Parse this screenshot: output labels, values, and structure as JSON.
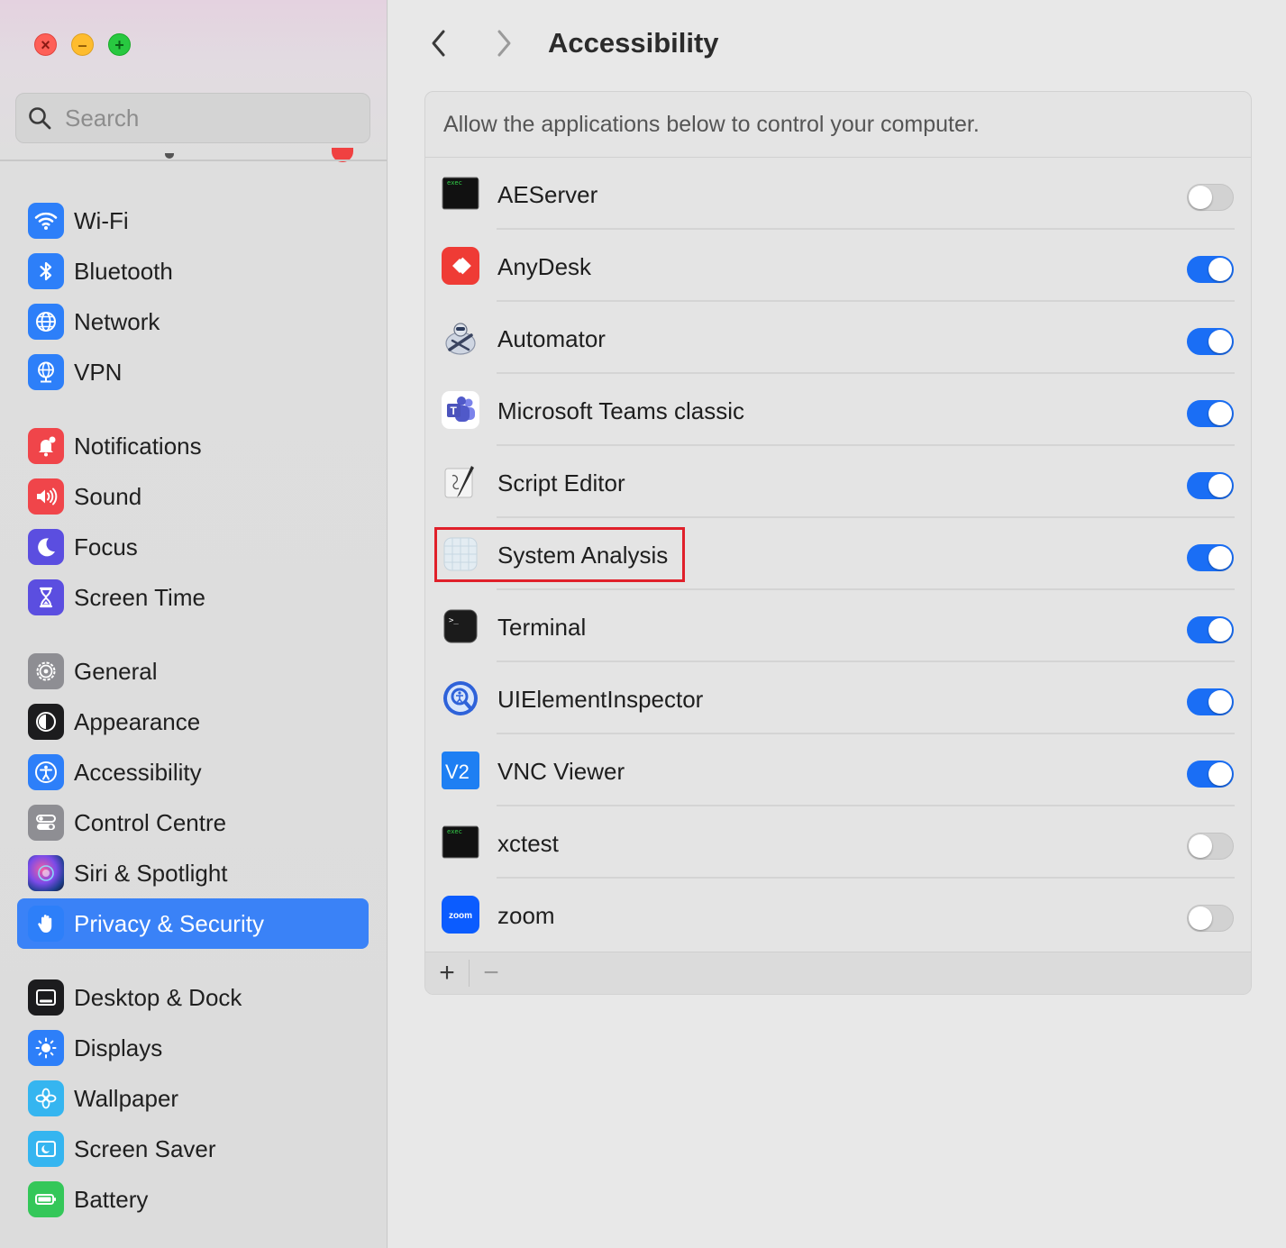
{
  "window": {
    "title": "Accessibility"
  },
  "search": {
    "placeholder": "Search"
  },
  "sidebar": {
    "items": [
      {
        "label": "Wi-Fi",
        "icon": "wifi-icon",
        "color": "#2d7ff9"
      },
      {
        "label": "Bluetooth",
        "icon": "bluetooth-icon",
        "color": "#2d7ff9"
      },
      {
        "label": "Network",
        "icon": "globe-icon",
        "color": "#2d7ff9"
      },
      {
        "label": "VPN",
        "icon": "vpn-globe-icon",
        "color": "#2d7ff9"
      },
      {
        "label": "Notifications",
        "icon": "bell-icon",
        "color": "#f0454a"
      },
      {
        "label": "Sound",
        "icon": "speaker-icon",
        "color": "#f0454a"
      },
      {
        "label": "Focus",
        "icon": "moon-icon",
        "color": "#5b4ee0"
      },
      {
        "label": "Screen Time",
        "icon": "hourglass-icon",
        "color": "#5b4ee0"
      },
      {
        "label": "General",
        "icon": "gear-icon",
        "color": "#8e8e93"
      },
      {
        "label": "Appearance",
        "icon": "appearance-icon",
        "color": "#1c1c1e"
      },
      {
        "label": "Accessibility",
        "icon": "accessibility-icon",
        "color": "#2d7ff9"
      },
      {
        "label": "Control Centre",
        "icon": "control-centre-icon",
        "color": "#8e8e93"
      },
      {
        "label": "Siri & Spotlight",
        "icon": "siri-icon",
        "color": "#2a1f4d"
      },
      {
        "label": "Privacy & Security",
        "icon": "hand-icon",
        "color": "#2d7ff9",
        "active": true
      },
      {
        "label": "Desktop & Dock",
        "icon": "dock-icon",
        "color": "#1c1c1e"
      },
      {
        "label": "Displays",
        "icon": "sun-icon",
        "color": "#2d7ff9"
      },
      {
        "label": "Wallpaper",
        "icon": "flower-icon",
        "color": "#35b5f0"
      },
      {
        "label": "Screen Saver",
        "icon": "screen-saver-icon",
        "color": "#35b5f0"
      },
      {
        "label": "Battery",
        "icon": "battery-icon",
        "color": "#34c759"
      }
    ]
  },
  "main": {
    "description": "Allow the applications below to control your computer.",
    "apps": [
      {
        "name": "AEServer",
        "icon": "exec-icon",
        "enabled": false
      },
      {
        "name": "AnyDesk",
        "icon": "anydesk-icon",
        "enabled": true
      },
      {
        "name": "Automator",
        "icon": "automator-icon",
        "enabled": true
      },
      {
        "name": "Microsoft Teams classic",
        "icon": "teams-icon",
        "enabled": true
      },
      {
        "name": "Script Editor",
        "icon": "script-editor-icon",
        "enabled": true
      },
      {
        "name": "System Analysis",
        "icon": "generic-app-icon",
        "enabled": true,
        "highlighted": true
      },
      {
        "name": "Terminal",
        "icon": "terminal-icon",
        "enabled": true
      },
      {
        "name": "UIElementInspector",
        "icon": "inspector-icon",
        "enabled": true
      },
      {
        "name": "VNC Viewer",
        "icon": "vnc-icon",
        "enabled": true
      },
      {
        "name": "xctest",
        "icon": "exec-icon",
        "enabled": false
      },
      {
        "name": "zoom",
        "icon": "zoom-icon",
        "enabled": false
      }
    ],
    "footer": {
      "add_label": "+",
      "remove_label": "−"
    }
  },
  "icon_texts": {
    "exec": "exec",
    "teams": "T",
    "terminal": ">_",
    "vnc": "V2",
    "zoom": "zoom"
  },
  "colors": {
    "accent": "#1a6ef5",
    "highlight_border": "#e0202a",
    "selection": "#3a82f7"
  }
}
